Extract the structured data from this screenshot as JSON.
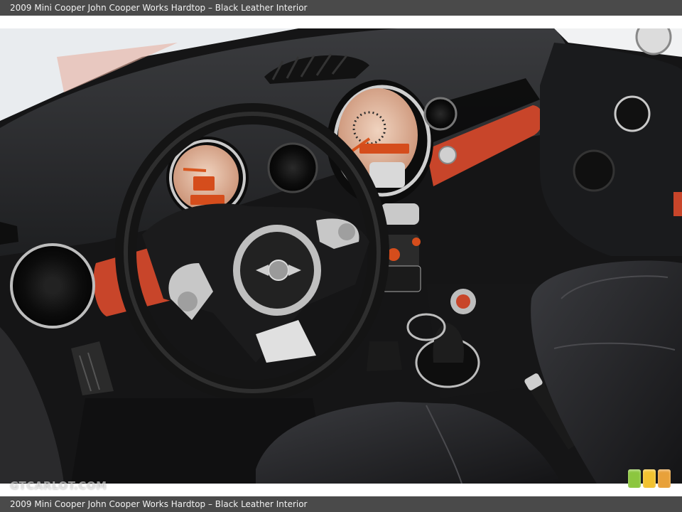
{
  "caption": {
    "top": "2009 Mini Cooper John Cooper Works Hardtop – Black Leather Interior",
    "bottom": "2009 Mini Cooper John Cooper Works Hardtop – Black Leather Interior"
  },
  "watermark": "GTCARLOT.COM",
  "colors": {
    "caption_bar": "#4a4a4a",
    "dashboard": "#2a2b2d",
    "leather": "#1c1c1e",
    "accent_orange": "#c8452a",
    "chrome": "#c8c8c8",
    "gauge_face": "#e4b9a0",
    "logo_green": "#8cc63f",
    "logo_yellow": "#f2c230",
    "logo_orange": "#e8a13a"
  },
  "icons": {
    "steering_wheel": "steering-wheel-icon",
    "speedometer": "speedometer-icon",
    "tachometer": "tachometer-icon",
    "mini_badge": "mini-winged-logo-icon",
    "air_vent": "air-vent-icon",
    "gear_shifter": "gear-shifter-icon",
    "handbrake": "handbrake-icon",
    "seat": "seat-icon"
  }
}
